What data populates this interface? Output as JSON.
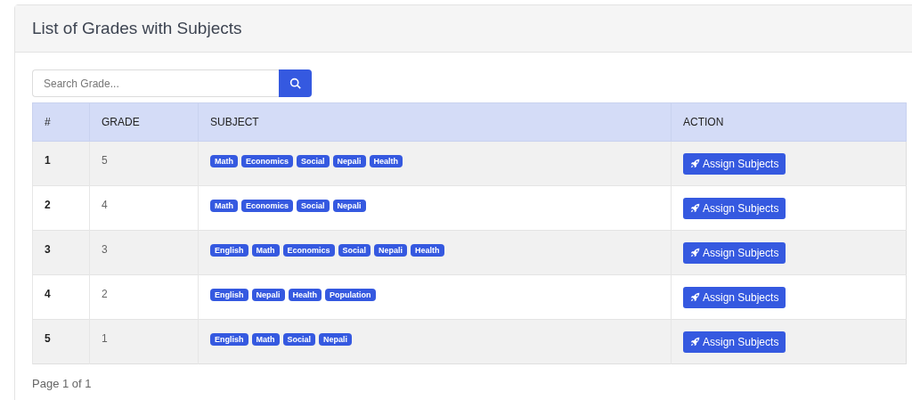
{
  "card": {
    "title": "List of Grades with Subjects"
  },
  "search": {
    "placeholder": "Search Grade..."
  },
  "table": {
    "columns": [
      "#",
      "GRADE",
      "SUBJECT",
      "ACTION"
    ],
    "rows": [
      {
        "index": "1",
        "grade": "5",
        "subjects": [
          "Math",
          "Economics",
          "Social",
          "Nepali",
          "Health"
        ],
        "action": "Assign Subjects"
      },
      {
        "index": "2",
        "grade": "4",
        "subjects": [
          "Math",
          "Economics",
          "Social",
          "Nepali"
        ],
        "action": "Assign Subjects"
      },
      {
        "index": "3",
        "grade": "3",
        "subjects": [
          "English",
          "Math",
          "Economics",
          "Social",
          "Nepali",
          "Health"
        ],
        "action": "Assign Subjects"
      },
      {
        "index": "4",
        "grade": "2",
        "subjects": [
          "English",
          "Nepali",
          "Health",
          "Population"
        ],
        "action": "Assign Subjects"
      },
      {
        "index": "5",
        "grade": "1",
        "subjects": [
          "English",
          "Math",
          "Social",
          "Nepali"
        ],
        "action": "Assign Subjects"
      }
    ]
  },
  "pagination": "Page 1 of 1"
}
